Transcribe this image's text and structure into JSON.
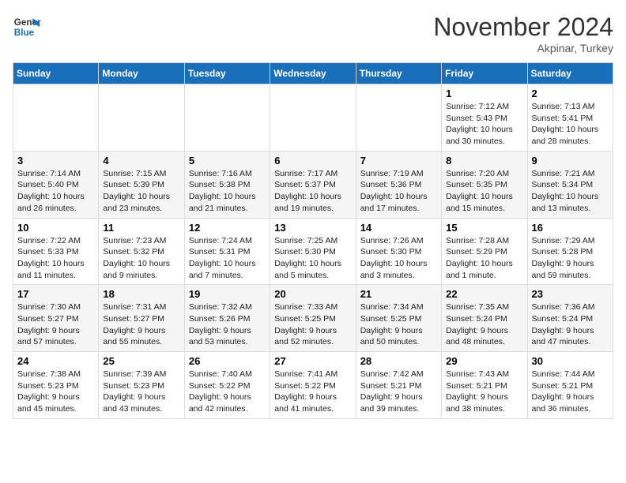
{
  "logo": {
    "line1": "General",
    "line2": "Blue"
  },
  "title": "November 2024",
  "subtitle": "Akpinar, Turkey",
  "days_header": [
    "Sunday",
    "Monday",
    "Tuesday",
    "Wednesday",
    "Thursday",
    "Friday",
    "Saturday"
  ],
  "weeks": [
    [
      {
        "day": "",
        "info": ""
      },
      {
        "day": "",
        "info": ""
      },
      {
        "day": "",
        "info": ""
      },
      {
        "day": "",
        "info": ""
      },
      {
        "day": "",
        "info": ""
      },
      {
        "day": "1",
        "info": "Sunrise: 7:12 AM\nSunset: 5:43 PM\nDaylight: 10 hours and 30 minutes."
      },
      {
        "day": "2",
        "info": "Sunrise: 7:13 AM\nSunset: 5:41 PM\nDaylight: 10 hours and 28 minutes."
      }
    ],
    [
      {
        "day": "3",
        "info": "Sunrise: 7:14 AM\nSunset: 5:40 PM\nDaylight: 10 hours and 26 minutes."
      },
      {
        "day": "4",
        "info": "Sunrise: 7:15 AM\nSunset: 5:39 PM\nDaylight: 10 hours and 23 minutes."
      },
      {
        "day": "5",
        "info": "Sunrise: 7:16 AM\nSunset: 5:38 PM\nDaylight: 10 hours and 21 minutes."
      },
      {
        "day": "6",
        "info": "Sunrise: 7:17 AM\nSunset: 5:37 PM\nDaylight: 10 hours and 19 minutes."
      },
      {
        "day": "7",
        "info": "Sunrise: 7:19 AM\nSunset: 5:36 PM\nDaylight: 10 hours and 17 minutes."
      },
      {
        "day": "8",
        "info": "Sunrise: 7:20 AM\nSunset: 5:35 PM\nDaylight: 10 hours and 15 minutes."
      },
      {
        "day": "9",
        "info": "Sunrise: 7:21 AM\nSunset: 5:34 PM\nDaylight: 10 hours and 13 minutes."
      }
    ],
    [
      {
        "day": "10",
        "info": "Sunrise: 7:22 AM\nSunset: 5:33 PM\nDaylight: 10 hours and 11 minutes."
      },
      {
        "day": "11",
        "info": "Sunrise: 7:23 AM\nSunset: 5:32 PM\nDaylight: 10 hours and 9 minutes."
      },
      {
        "day": "12",
        "info": "Sunrise: 7:24 AM\nSunset: 5:31 PM\nDaylight: 10 hours and 7 minutes."
      },
      {
        "day": "13",
        "info": "Sunrise: 7:25 AM\nSunset: 5:30 PM\nDaylight: 10 hours and 5 minutes."
      },
      {
        "day": "14",
        "info": "Sunrise: 7:26 AM\nSunset: 5:30 PM\nDaylight: 10 hours and 3 minutes."
      },
      {
        "day": "15",
        "info": "Sunrise: 7:28 AM\nSunset: 5:29 PM\nDaylight: 10 hours and 1 minute."
      },
      {
        "day": "16",
        "info": "Sunrise: 7:29 AM\nSunset: 5:28 PM\nDaylight: 9 hours and 59 minutes."
      }
    ],
    [
      {
        "day": "17",
        "info": "Sunrise: 7:30 AM\nSunset: 5:27 PM\nDaylight: 9 hours and 57 minutes."
      },
      {
        "day": "18",
        "info": "Sunrise: 7:31 AM\nSunset: 5:27 PM\nDaylight: 9 hours and 55 minutes."
      },
      {
        "day": "19",
        "info": "Sunrise: 7:32 AM\nSunset: 5:26 PM\nDaylight: 9 hours and 53 minutes."
      },
      {
        "day": "20",
        "info": "Sunrise: 7:33 AM\nSunset: 5:25 PM\nDaylight: 9 hours and 52 minutes."
      },
      {
        "day": "21",
        "info": "Sunrise: 7:34 AM\nSunset: 5:25 PM\nDaylight: 9 hours and 50 minutes."
      },
      {
        "day": "22",
        "info": "Sunrise: 7:35 AM\nSunset: 5:24 PM\nDaylight: 9 hours and 48 minutes."
      },
      {
        "day": "23",
        "info": "Sunrise: 7:36 AM\nSunset: 5:24 PM\nDaylight: 9 hours and 47 minutes."
      }
    ],
    [
      {
        "day": "24",
        "info": "Sunrise: 7:38 AM\nSunset: 5:23 PM\nDaylight: 9 hours and 45 minutes."
      },
      {
        "day": "25",
        "info": "Sunrise: 7:39 AM\nSunset: 5:23 PM\nDaylight: 9 hours and 43 minutes."
      },
      {
        "day": "26",
        "info": "Sunrise: 7:40 AM\nSunset: 5:22 PM\nDaylight: 9 hours and 42 minutes."
      },
      {
        "day": "27",
        "info": "Sunrise: 7:41 AM\nSunset: 5:22 PM\nDaylight: 9 hours and 41 minutes."
      },
      {
        "day": "28",
        "info": "Sunrise: 7:42 AM\nSunset: 5:21 PM\nDaylight: 9 hours and 39 minutes."
      },
      {
        "day": "29",
        "info": "Sunrise: 7:43 AM\nSunset: 5:21 PM\nDaylight: 9 hours and 38 minutes."
      },
      {
        "day": "30",
        "info": "Sunrise: 7:44 AM\nSunset: 5:21 PM\nDaylight: 9 hours and 36 minutes."
      }
    ]
  ]
}
